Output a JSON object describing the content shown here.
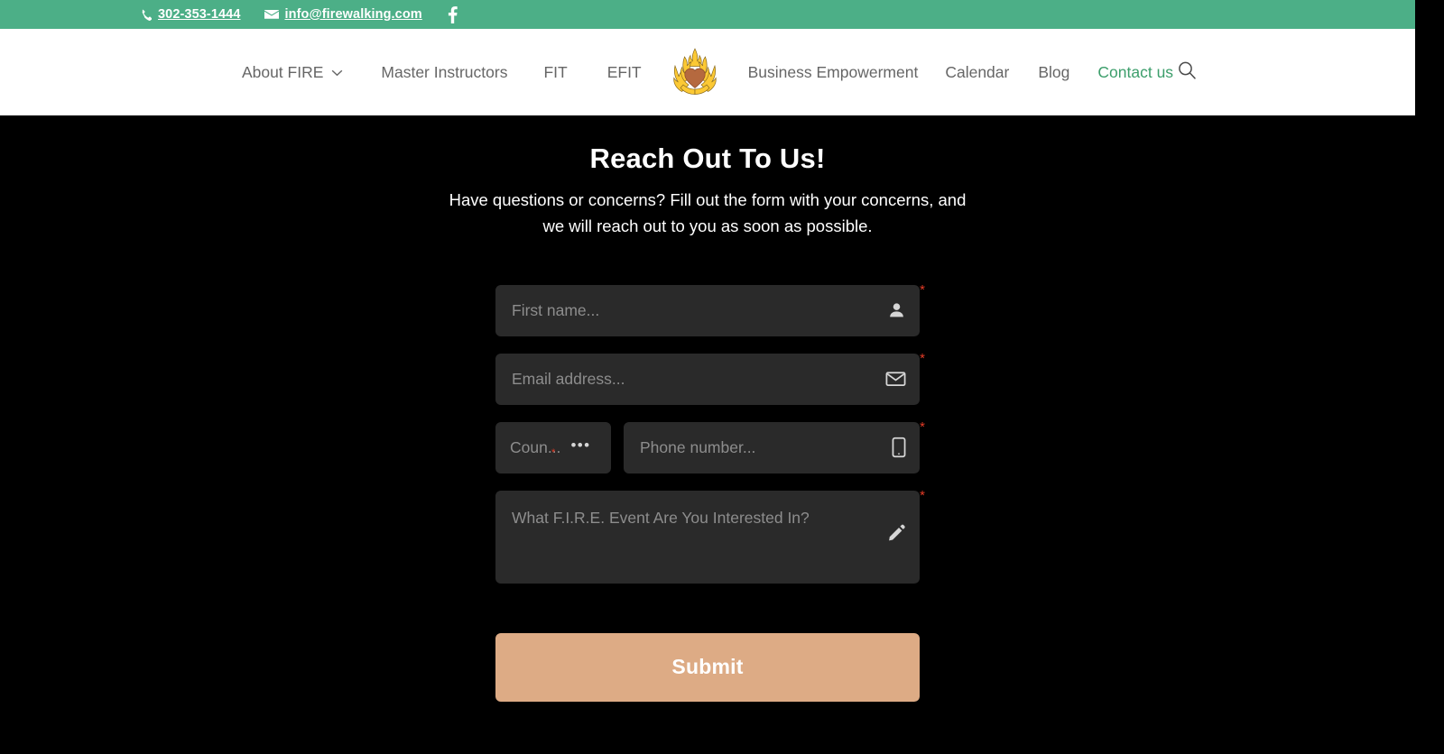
{
  "topbar": {
    "phone": "302-353-1444",
    "email": "info@firewalking.com",
    "phone_icon": "phone-icon",
    "email_icon": "envelope-icon",
    "facebook_icon": "facebook-icon",
    "bg_color": "#4caf87"
  },
  "nav": {
    "items": [
      {
        "label": "About FIRE",
        "has_dropdown": true,
        "accent": false
      },
      {
        "label": "Master Instructors",
        "has_dropdown": false,
        "accent": false
      },
      {
        "label": "FIT",
        "has_dropdown": false,
        "accent": false
      },
      {
        "label": "EFIT",
        "has_dropdown": false,
        "accent": false
      },
      {
        "label": "Business Empowerment",
        "has_dropdown": false,
        "accent": false
      },
      {
        "label": "Calendar",
        "has_dropdown": false,
        "accent": false
      },
      {
        "label": "Blog",
        "has_dropdown": false,
        "accent": false
      },
      {
        "label": "Contact us",
        "has_dropdown": false,
        "accent": true
      }
    ],
    "logo_name": "firewalking-flame-heart-logo",
    "search_icon": "search-icon",
    "accent_color": "#3c9e6b",
    "link_color": "#666666"
  },
  "hero": {
    "title": "Reach Out To Us!",
    "subtitle": "Have questions or concerns? Fill out the form with your concerns, and we will reach out to you as soon as possible."
  },
  "form": {
    "first_name": {
      "placeholder": "First name...",
      "value": "",
      "icon": "person-icon",
      "required_marker": "*"
    },
    "email": {
      "placeholder": "Email address...",
      "value": "",
      "icon": "envelope-icon",
      "required_marker": "*"
    },
    "country": {
      "label": "Coun...",
      "dots": "•••",
      "icon": "ellipsis-icon",
      "required_marker": "*"
    },
    "phone": {
      "placeholder": "Phone number...",
      "value": "",
      "icon": "mobile-phone-icon",
      "required_marker": "*"
    },
    "message": {
      "placeholder": "What F.I.R.E. Event Are You Interested In?",
      "value": "",
      "icon": "pencil-icon",
      "required_marker": "*"
    },
    "submit_label": "Submit",
    "submit_color": "#ddab85",
    "required_color": "#e23b26",
    "field_bg": "#2a2a2a"
  }
}
